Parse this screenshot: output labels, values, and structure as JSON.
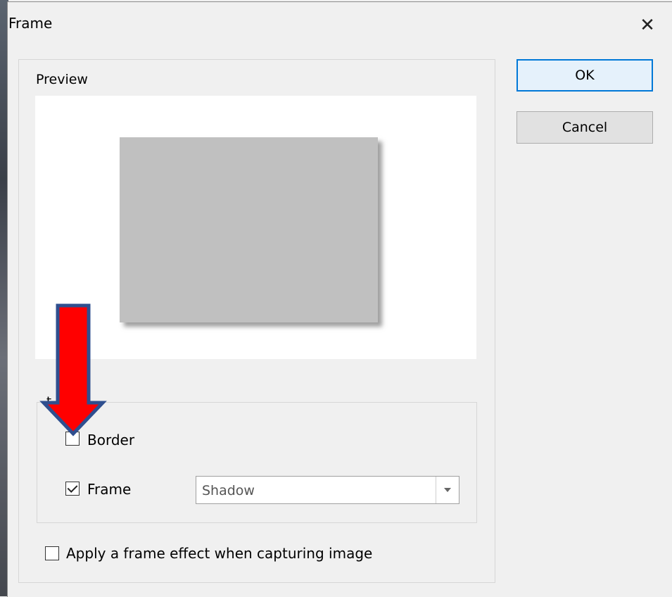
{
  "window": {
    "title": "Frame"
  },
  "preview": {
    "label": "Preview"
  },
  "effect_group": {
    "label": "t"
  },
  "options": {
    "border": {
      "label": "Border",
      "checked": false
    },
    "frame": {
      "label": "Frame",
      "checked": true,
      "style_value": "Shadow"
    },
    "apply_on_capture": {
      "label": "Apply a frame effect when capturing image",
      "checked": false
    }
  },
  "buttons": {
    "ok": "OK",
    "cancel": "Cancel"
  },
  "icons": {
    "close": "close-icon",
    "dropdown": "chevron-down-icon",
    "annotation": "red-arrow-icon"
  },
  "colors": {
    "annotation_fill": "#ff0000",
    "annotation_stroke": "#2f4f8f",
    "accent": "#0078d7"
  }
}
